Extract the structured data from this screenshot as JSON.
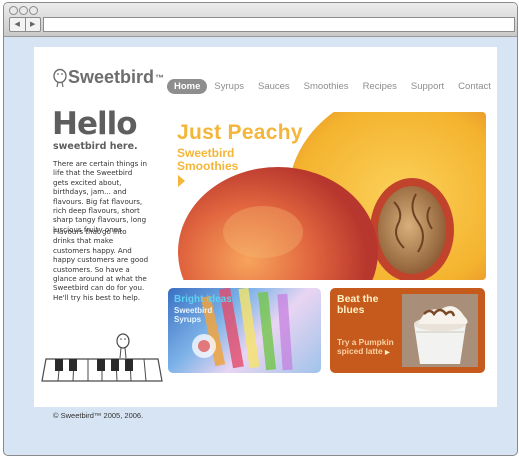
{
  "browser": {
    "back_glyph": "◀",
    "forward_glyph": "▶",
    "url": ""
  },
  "brand": {
    "name": "Sweetbird",
    "tm": "™"
  },
  "nav": {
    "items": [
      {
        "label": "Home",
        "active": true
      },
      {
        "label": "Syrups",
        "active": false
      },
      {
        "label": "Sauces",
        "active": false
      },
      {
        "label": "Smoothies",
        "active": false
      },
      {
        "label": "Recipes",
        "active": false
      },
      {
        "label": "Support",
        "active": false
      },
      {
        "label": "Contact",
        "active": false
      }
    ]
  },
  "intro": {
    "heading": "Hello",
    "subheading": "sweetbird here.",
    "para1": "There are certain things in life that the Sweetbird gets excited about, birthdays, jam... and flavours. Big fat flavours, rich deep flavours, short sharp tangy flavours, long luscious fruity ones.",
    "para2": "Flavours that go into drinks that make customers happy. And happy customers are good customers. So have a glance around at what the Sweetbird can do for you. He'll try his best to help."
  },
  "hero": {
    "title": "Just Peachy",
    "subtitle_line1": "Sweetbird",
    "subtitle_line2": "Smoothies"
  },
  "promos": [
    {
      "title": "Bright ideas",
      "subtitle": "Sweetbird Syrups"
    },
    {
      "title": "Beat the blues",
      "subtitle": "Try a Pumpkin spiced latte",
      "arrow": "▶"
    }
  ],
  "footer": {
    "copyright": "© Sweetbird™ 2005, 2006."
  },
  "colors": {
    "accent": "#f3b63a",
    "promo_orange": "#c6591c",
    "nav_active": "#8e8e8e",
    "window_bg": "#d7e4f3"
  }
}
